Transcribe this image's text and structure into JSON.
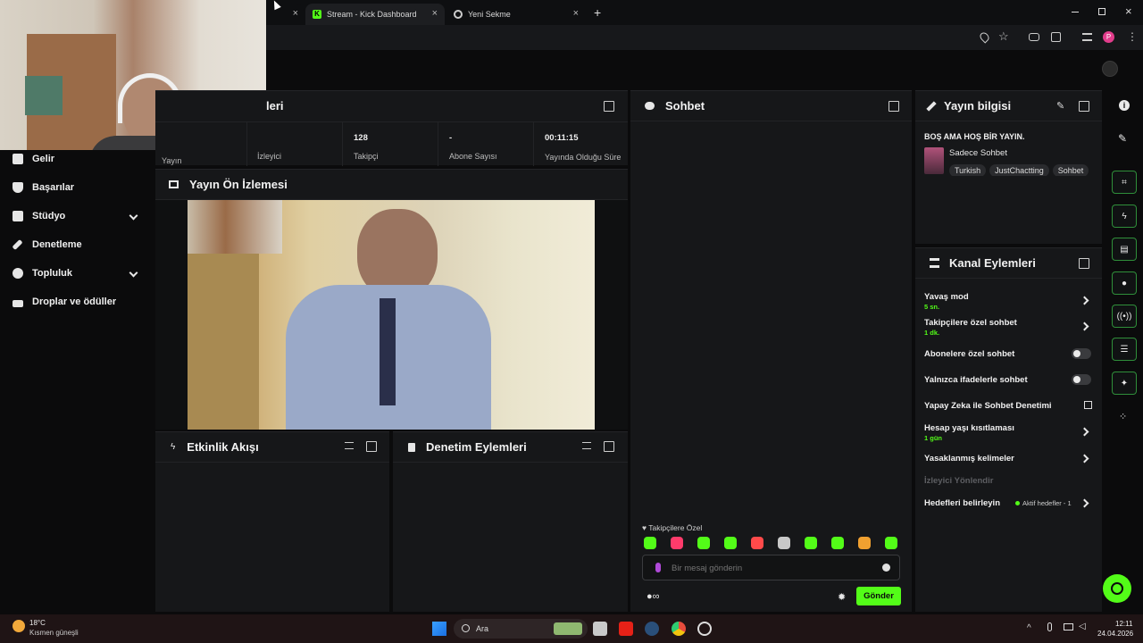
{
  "browser": {
    "tabs": [
      {
        "label": "Stream - Kick Dashboard",
        "active": true
      },
      {
        "label": "Yeni Sekme",
        "active": false
      }
    ],
    "new_tab": "+"
  },
  "sidebar": {
    "items": [
      {
        "label": "Gelir",
        "icon": "chart-icon"
      },
      {
        "label": "Başarılar",
        "icon": "trophy-icon"
      },
      {
        "label": "Stüdyo",
        "icon": "studio-icon",
        "expandable": true
      },
      {
        "label": "Denetleme",
        "icon": "wrench-icon"
      },
      {
        "label": "Topluluk",
        "icon": "community-icon",
        "expandable": true
      },
      {
        "label": "Droplar ve ödüller",
        "icon": "drops-icon"
      }
    ]
  },
  "stats": {
    "title_fragment": "leri",
    "items": [
      {
        "value": "",
        "label": "Yayın"
      },
      {
        "value": "",
        "label": "İzleyici"
      },
      {
        "value": "128",
        "label": "Takipçi"
      },
      {
        "value": "-",
        "label": "Abone Sayısı"
      },
      {
        "value": "00:11:15",
        "label": "Yayında Olduğu Süre"
      }
    ]
  },
  "preview": {
    "title": "Yayın Ön İzlemesi"
  },
  "activity": {
    "title": "Etkinlik Akışı"
  },
  "modactions": {
    "title": "Denetim Eylemleri"
  },
  "chat": {
    "title": "Sohbet",
    "mode_label": "Takipçilere Özel",
    "placeholder": "Bir mesaj gönderin",
    "send_label": "Gönder",
    "emote_colors": [
      "#53fc18",
      "#ff3b6b",
      "#53fc18",
      "#53fc18",
      "#ff4a4a",
      "#c8c8c8",
      "#53fc18",
      "#53fc18",
      "#f0a030",
      "#53fc18"
    ]
  },
  "streaminfo": {
    "title": "Yayın bilgisi",
    "stream_title": "BOŞ AMA HOŞ BİR YAYIN.",
    "category": "Sadece Sohbet",
    "tags": [
      "Turkish",
      "JustChactting",
      "Sohbet"
    ]
  },
  "channel_actions": {
    "title": "Kanal Eylemleri",
    "items": [
      {
        "label": "Yavaş mod",
        "sub": "5 sn."
      },
      {
        "label": "Takipçilere özel sohbet",
        "sub": "1 dk."
      },
      {
        "label": "Abonelere özel sohbet",
        "sub": ""
      },
      {
        "label": "Yalnızca ifadelerle sohbet",
        "sub": ""
      },
      {
        "label": "Yapay Zeka ile Sohbet Denetimi",
        "sub": ""
      },
      {
        "label": "Hesap yaşı kısıtlaması",
        "sub": "1 gün"
      },
      {
        "label": "Yasaklanmış kelimeler",
        "sub": ""
      },
      {
        "label": "İzleyici Yönlendir",
        "sub": ""
      },
      {
        "label": "Hedefleri belirleyin",
        "sub": ""
      }
    ],
    "goals_status": "Aktif hedefler - 1"
  },
  "taskbar": {
    "weather_temp": "18°C",
    "weather_desc": "Kısmen güneşli",
    "search_label": "Ara",
    "time": "12:11",
    "date": "24.04.2026"
  },
  "colors": {
    "accent": "#53fc18",
    "panel": "#161719",
    "bg": "#0b0b0c"
  }
}
